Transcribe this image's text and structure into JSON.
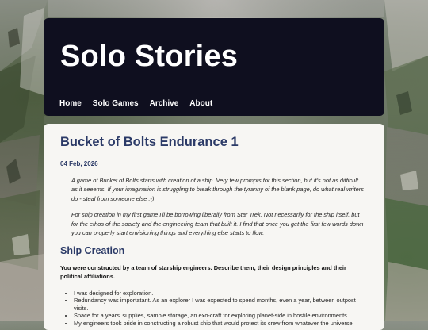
{
  "site": {
    "title": "Solo Stories",
    "nav": [
      "Home",
      "Solo Games",
      "Archive",
      "About"
    ]
  },
  "post": {
    "title": "Bucket of Bolts Endurance 1",
    "date": "04 Feb, 2026",
    "intro": [
      "A game of Bucket of Bolts starts with creation of a ship. Very few prompts for this section, but it's not as difficult as it seeems. If your imagination is struggling to break through the tyranny of the blank page, do what real writers do - steal from someone else :-)",
      "For ship creation in my first game I'll be borrowing liberally from Star Trek. Not necessarily for the ship itself, but for the ethos of the society and the engineering team that built it. I find that once you get the first few words down you can properly start envisioning things and everything else starts to flow."
    ],
    "section": {
      "title": "Ship Creation",
      "prompt": "You were constructed by a team of starship engineers. Describe them, their design principles and their political affiliations.",
      "items": [
        "I was designed for exploration.",
        "Redundancy was importatant. As an explorer I was expected to spend months, even a year, between outpost visits.",
        "Space for a years' supplies, sample storage, an exo-craft for exploring planet-side in hostile environments.",
        "My engineers took pride in constructing a robust ship that would protect its crew from whatever the universe"
      ]
    }
  }
}
